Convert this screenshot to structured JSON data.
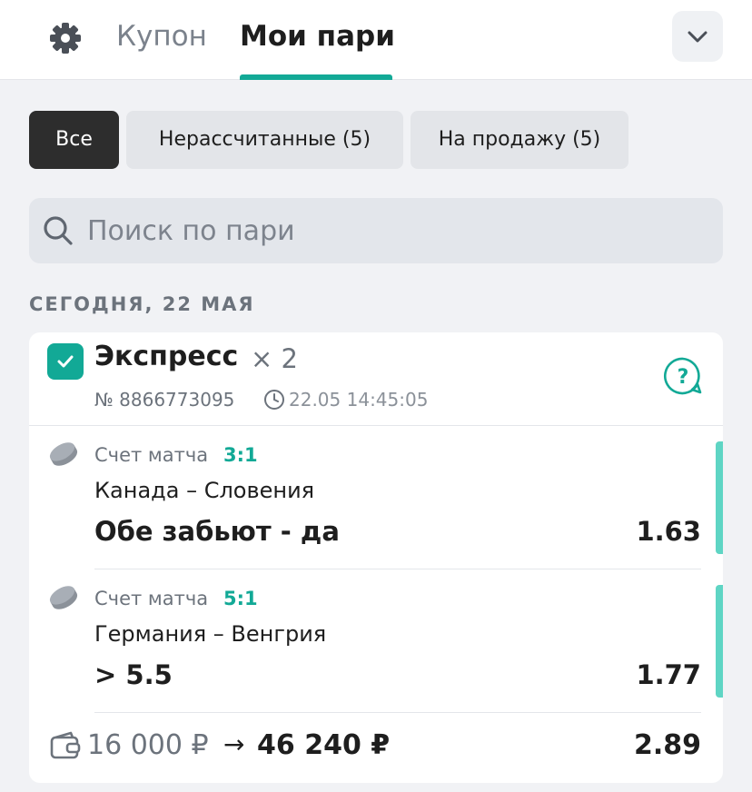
{
  "header": {
    "tabs": [
      {
        "label": "Купон",
        "active": false
      },
      {
        "label": "Мои пари",
        "active": true
      }
    ]
  },
  "filters": [
    {
      "label": "Все",
      "active": true
    },
    {
      "label": "Нерассчитанные (5)",
      "active": false
    },
    {
      "label": "На продажу (5)",
      "active": false
    }
  ],
  "search": {
    "placeholder": "Поиск по пари",
    "value": ""
  },
  "section": {
    "date_label": "СЕГОДНЯ, 22 МАЯ"
  },
  "bet": {
    "title": "Экспресс",
    "multiplier": "× 2",
    "number": "№ 8866773095",
    "time": "22.05 14:45:05",
    "legs": [
      {
        "kind": "Счет матча",
        "score": "3:1",
        "match": "Канада – Словения",
        "outcome": "Обе забьют - да",
        "odds": "1.63"
      },
      {
        "kind": "Счет матча",
        "score": "5:1",
        "match": "Германия – Венгрия",
        "outcome": "> 5.5",
        "odds": "1.77"
      }
    ],
    "stake": "16 000 ₽",
    "arrow": "→",
    "payout": "46 240 ₽",
    "total_odds": "2.89"
  },
  "colors": {
    "accent": "#12a996",
    "accent_light": "#5fd5c4",
    "dark_chip": "#2d2d2d"
  },
  "icons": [
    "gear-icon",
    "chevron-down-icon",
    "search-icon",
    "checkbox-icon",
    "clock-icon",
    "help-icon",
    "hockey-puck-icon",
    "wallet-icon"
  ]
}
